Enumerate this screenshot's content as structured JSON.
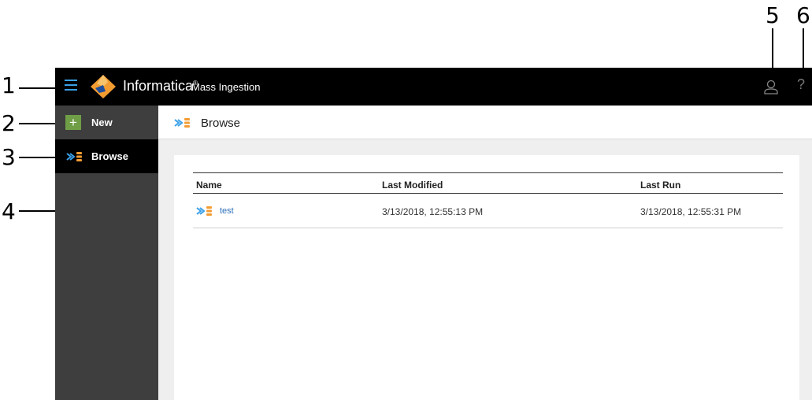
{
  "callouts": [
    "1",
    "2",
    "3",
    "4",
    "5",
    "6"
  ],
  "header": {
    "brand": "Informatica",
    "trademark": "®",
    "product": "Mass Ingestion",
    "help_symbol": "?"
  },
  "sidebar": {
    "items": [
      {
        "label": "New",
        "icon": "plus-icon"
      },
      {
        "label": "Browse",
        "icon": "ingestion-icon"
      }
    ],
    "new_symbol": "+"
  },
  "page": {
    "title": "Browse"
  },
  "table": {
    "columns": [
      "Name",
      "Last Modified",
      "Last Run"
    ],
    "rows": [
      {
        "name": "test",
        "last_modified": "3/13/2018, 12:55:13 PM",
        "last_run": "3/13/2018, 12:55:31 PM"
      }
    ]
  },
  "colors": {
    "topbar": "#000000",
    "sidebar": "#3e3e3e",
    "accent_blue": "#3aa0e8",
    "accent_orange": "#f39c32",
    "new_green": "#6f9e47",
    "link": "#2b6fb9"
  }
}
